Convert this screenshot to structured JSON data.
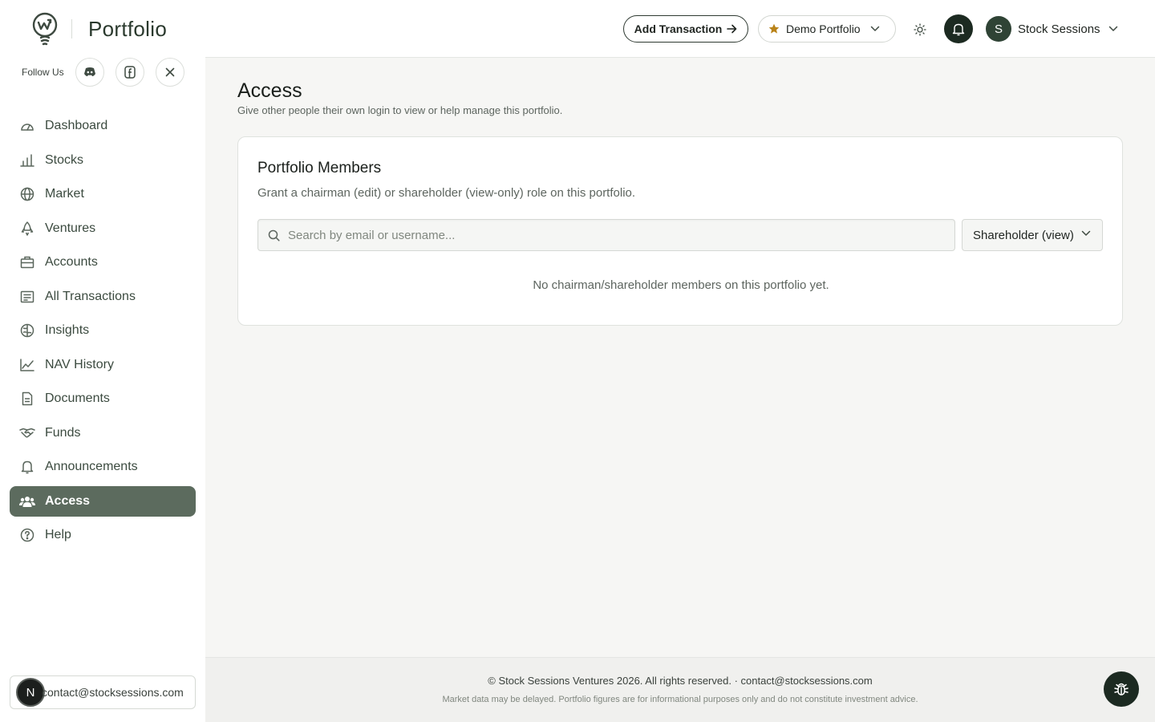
{
  "brand": {
    "title": "Portfolio",
    "logo_icon": "brand-logo-icon"
  },
  "follow": {
    "label": "Follow Us",
    "socials": [
      "discord-icon",
      "facebook-icon",
      "x-icon"
    ]
  },
  "sidebar": {
    "items": [
      {
        "label": "Dashboard",
        "icon": "gauge-icon"
      },
      {
        "label": "Stocks",
        "icon": "bar-chart-icon"
      },
      {
        "label": "Market",
        "icon": "globe-icon"
      },
      {
        "label": "Ventures",
        "icon": "rocket-icon"
      },
      {
        "label": "Accounts",
        "icon": "briefcase-icon"
      },
      {
        "label": "All Transactions",
        "icon": "receipt-icon"
      },
      {
        "label": "Insights",
        "icon": "brain-icon"
      },
      {
        "label": "NAV History",
        "icon": "line-chart-icon"
      },
      {
        "label": "Documents",
        "icon": "document-icon"
      },
      {
        "label": "Funds",
        "icon": "handshake-icon"
      },
      {
        "label": "Announcements",
        "icon": "bell-icon"
      },
      {
        "label": "Access",
        "icon": "users-icon",
        "active": true
      },
      {
        "label": "Help",
        "icon": "help-icon"
      }
    ],
    "user_chip": {
      "initial": "N",
      "email": "contact@stocksessions.com"
    }
  },
  "header": {
    "add_transaction_label": "Add Transaction",
    "portfolio_selector": "Demo Portfolio",
    "profile": {
      "initial": "S",
      "name": "Stock Sessions"
    }
  },
  "main": {
    "title": "Access",
    "subtitle": "Give other people their own login to view or help manage this portfolio.",
    "card": {
      "title": "Portfolio Members",
      "description": "Grant a chairman (edit) or shareholder (view-only) role on this portfolio.",
      "search_placeholder": "Search by email or username...",
      "role_selected": "Shareholder (view)",
      "empty_message": "No chairman/shareholder members on this portfolio yet."
    }
  },
  "footer": {
    "copyright": "© Stock Sessions Ventures 2026. All rights reserved. · contact@stocksessions.com",
    "disclaimer": "Market data may be delayed. Portfolio figures are for informational purposes only and do not constitute investment advice."
  },
  "colors": {
    "accent": "#5c6b5e",
    "dark_button": "#1c2a21",
    "star": "#b98319"
  }
}
